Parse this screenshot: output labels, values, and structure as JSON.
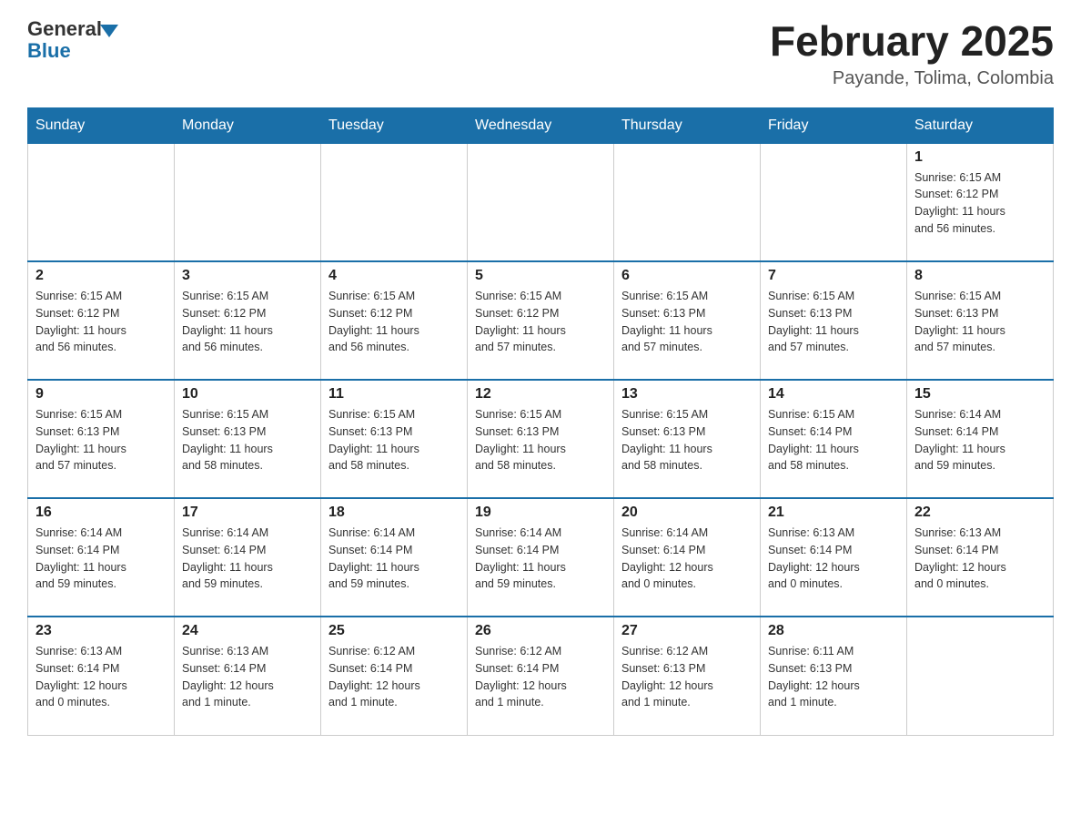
{
  "header": {
    "logo_general": "General",
    "logo_blue": "Blue",
    "title": "February 2025",
    "subtitle": "Payande, Tolima, Colombia"
  },
  "days_of_week": [
    "Sunday",
    "Monday",
    "Tuesday",
    "Wednesday",
    "Thursday",
    "Friday",
    "Saturday"
  ],
  "weeks": [
    [
      {
        "day": "",
        "info": ""
      },
      {
        "day": "",
        "info": ""
      },
      {
        "day": "",
        "info": ""
      },
      {
        "day": "",
        "info": ""
      },
      {
        "day": "",
        "info": ""
      },
      {
        "day": "",
        "info": ""
      },
      {
        "day": "1",
        "info": "Sunrise: 6:15 AM\nSunset: 6:12 PM\nDaylight: 11 hours\nand 56 minutes."
      }
    ],
    [
      {
        "day": "2",
        "info": "Sunrise: 6:15 AM\nSunset: 6:12 PM\nDaylight: 11 hours\nand 56 minutes."
      },
      {
        "day": "3",
        "info": "Sunrise: 6:15 AM\nSunset: 6:12 PM\nDaylight: 11 hours\nand 56 minutes."
      },
      {
        "day": "4",
        "info": "Sunrise: 6:15 AM\nSunset: 6:12 PM\nDaylight: 11 hours\nand 56 minutes."
      },
      {
        "day": "5",
        "info": "Sunrise: 6:15 AM\nSunset: 6:12 PM\nDaylight: 11 hours\nand 57 minutes."
      },
      {
        "day": "6",
        "info": "Sunrise: 6:15 AM\nSunset: 6:13 PM\nDaylight: 11 hours\nand 57 minutes."
      },
      {
        "day": "7",
        "info": "Sunrise: 6:15 AM\nSunset: 6:13 PM\nDaylight: 11 hours\nand 57 minutes."
      },
      {
        "day": "8",
        "info": "Sunrise: 6:15 AM\nSunset: 6:13 PM\nDaylight: 11 hours\nand 57 minutes."
      }
    ],
    [
      {
        "day": "9",
        "info": "Sunrise: 6:15 AM\nSunset: 6:13 PM\nDaylight: 11 hours\nand 57 minutes."
      },
      {
        "day": "10",
        "info": "Sunrise: 6:15 AM\nSunset: 6:13 PM\nDaylight: 11 hours\nand 58 minutes."
      },
      {
        "day": "11",
        "info": "Sunrise: 6:15 AM\nSunset: 6:13 PM\nDaylight: 11 hours\nand 58 minutes."
      },
      {
        "day": "12",
        "info": "Sunrise: 6:15 AM\nSunset: 6:13 PM\nDaylight: 11 hours\nand 58 minutes."
      },
      {
        "day": "13",
        "info": "Sunrise: 6:15 AM\nSunset: 6:13 PM\nDaylight: 11 hours\nand 58 minutes."
      },
      {
        "day": "14",
        "info": "Sunrise: 6:15 AM\nSunset: 6:14 PM\nDaylight: 11 hours\nand 58 minutes."
      },
      {
        "day": "15",
        "info": "Sunrise: 6:14 AM\nSunset: 6:14 PM\nDaylight: 11 hours\nand 59 minutes."
      }
    ],
    [
      {
        "day": "16",
        "info": "Sunrise: 6:14 AM\nSunset: 6:14 PM\nDaylight: 11 hours\nand 59 minutes."
      },
      {
        "day": "17",
        "info": "Sunrise: 6:14 AM\nSunset: 6:14 PM\nDaylight: 11 hours\nand 59 minutes."
      },
      {
        "day": "18",
        "info": "Sunrise: 6:14 AM\nSunset: 6:14 PM\nDaylight: 11 hours\nand 59 minutes."
      },
      {
        "day": "19",
        "info": "Sunrise: 6:14 AM\nSunset: 6:14 PM\nDaylight: 11 hours\nand 59 minutes."
      },
      {
        "day": "20",
        "info": "Sunrise: 6:14 AM\nSunset: 6:14 PM\nDaylight: 12 hours\nand 0 minutes."
      },
      {
        "day": "21",
        "info": "Sunrise: 6:13 AM\nSunset: 6:14 PM\nDaylight: 12 hours\nand 0 minutes."
      },
      {
        "day": "22",
        "info": "Sunrise: 6:13 AM\nSunset: 6:14 PM\nDaylight: 12 hours\nand 0 minutes."
      }
    ],
    [
      {
        "day": "23",
        "info": "Sunrise: 6:13 AM\nSunset: 6:14 PM\nDaylight: 12 hours\nand 0 minutes."
      },
      {
        "day": "24",
        "info": "Sunrise: 6:13 AM\nSunset: 6:14 PM\nDaylight: 12 hours\nand 1 minute."
      },
      {
        "day": "25",
        "info": "Sunrise: 6:12 AM\nSunset: 6:14 PM\nDaylight: 12 hours\nand 1 minute."
      },
      {
        "day": "26",
        "info": "Sunrise: 6:12 AM\nSunset: 6:14 PM\nDaylight: 12 hours\nand 1 minute."
      },
      {
        "day": "27",
        "info": "Sunrise: 6:12 AM\nSunset: 6:13 PM\nDaylight: 12 hours\nand 1 minute."
      },
      {
        "day": "28",
        "info": "Sunrise: 6:11 AM\nSunset: 6:13 PM\nDaylight: 12 hours\nand 1 minute."
      },
      {
        "day": "",
        "info": ""
      }
    ]
  ]
}
